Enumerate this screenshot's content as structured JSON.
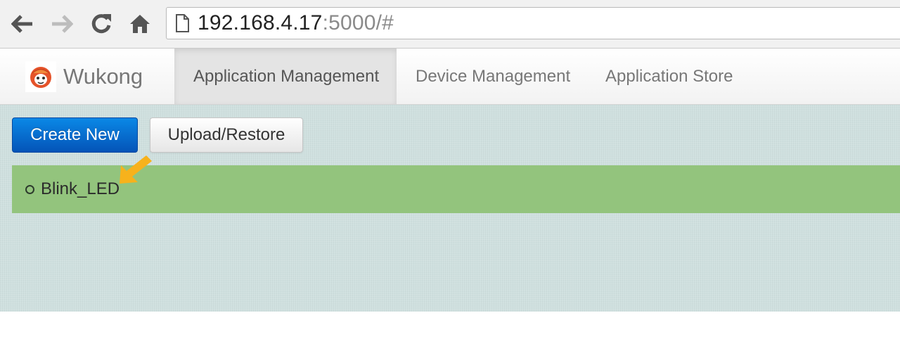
{
  "browser": {
    "url_host": "192.168.4.17",
    "url_rest": ":5000/#",
    "icons": [
      "back-arrow-icon",
      "forward-arrow-icon",
      "reload-icon",
      "home-icon",
      "page-icon"
    ]
  },
  "navbar": {
    "brand": "Wukong",
    "tabs": [
      {
        "label": "Application Management",
        "active": true
      },
      {
        "label": "Device Management",
        "active": false
      },
      {
        "label": "Application Store",
        "active": false
      }
    ]
  },
  "toolbar": {
    "create_label": "Create New",
    "upload_label": "Upload/Restore"
  },
  "applications": [
    {
      "name": "Blink_LED"
    }
  ],
  "colors": {
    "primary_button": "#0a6fd4",
    "app_row": "#93c47d",
    "content_bg": "#cfe0df",
    "annotation_arrow": "#f7b21c",
    "brand_logo": "#e5532a"
  }
}
